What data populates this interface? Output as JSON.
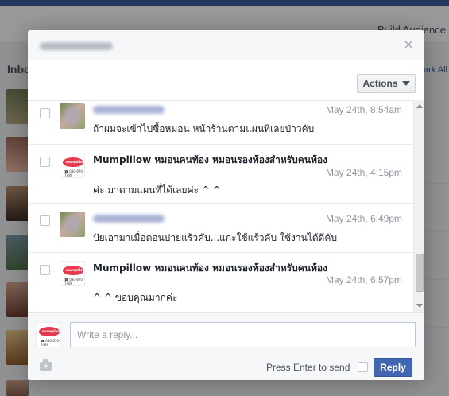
{
  "background": {
    "build_audience": "Build Audience",
    "inbox": "Inbo",
    "mark_all": "ark All"
  },
  "dialog": {
    "close_glyph": "×",
    "actions_label": "Actions"
  },
  "messages": [
    {
      "sender": "",
      "time": "May 24th, 8:54am",
      "text": "ถ้าผมจะเข้าไปซื้อหมอน หน้าร้านตามแผนที่เลยป่าวคับ"
    },
    {
      "sender": "Mumpillow หมอนคนท้อง หมอนรองท้องสำหรับคนท้อง",
      "time": "May 24th, 4:15pm",
      "text": "ค่ะ  มาตามแผนที่ได้เลยค่ะ  ^ ^"
    },
    {
      "sender": "",
      "time": "May 24th, 6:49pm",
      "text": "ปัยเอามาเมื่อตอนบ่ายแร้วคับ...แกะใช้แร้วคับ ใช้งานได้ดีคับ"
    },
    {
      "sender": "Mumpillow หมอนคนท้อง หมอนรองท้องสำหรับคนท้อง",
      "time": "May 24th, 6:57pm",
      "text": "^ ^ ขอบคุณมากค่ะ"
    }
  ],
  "page_logo": {
    "brand": "mumpillow",
    "tagline": "☎ 080-670-7489"
  },
  "composer": {
    "placeholder": "Write a reply...",
    "enter_label": "Press Enter to send",
    "reply_label": "Reply"
  }
}
